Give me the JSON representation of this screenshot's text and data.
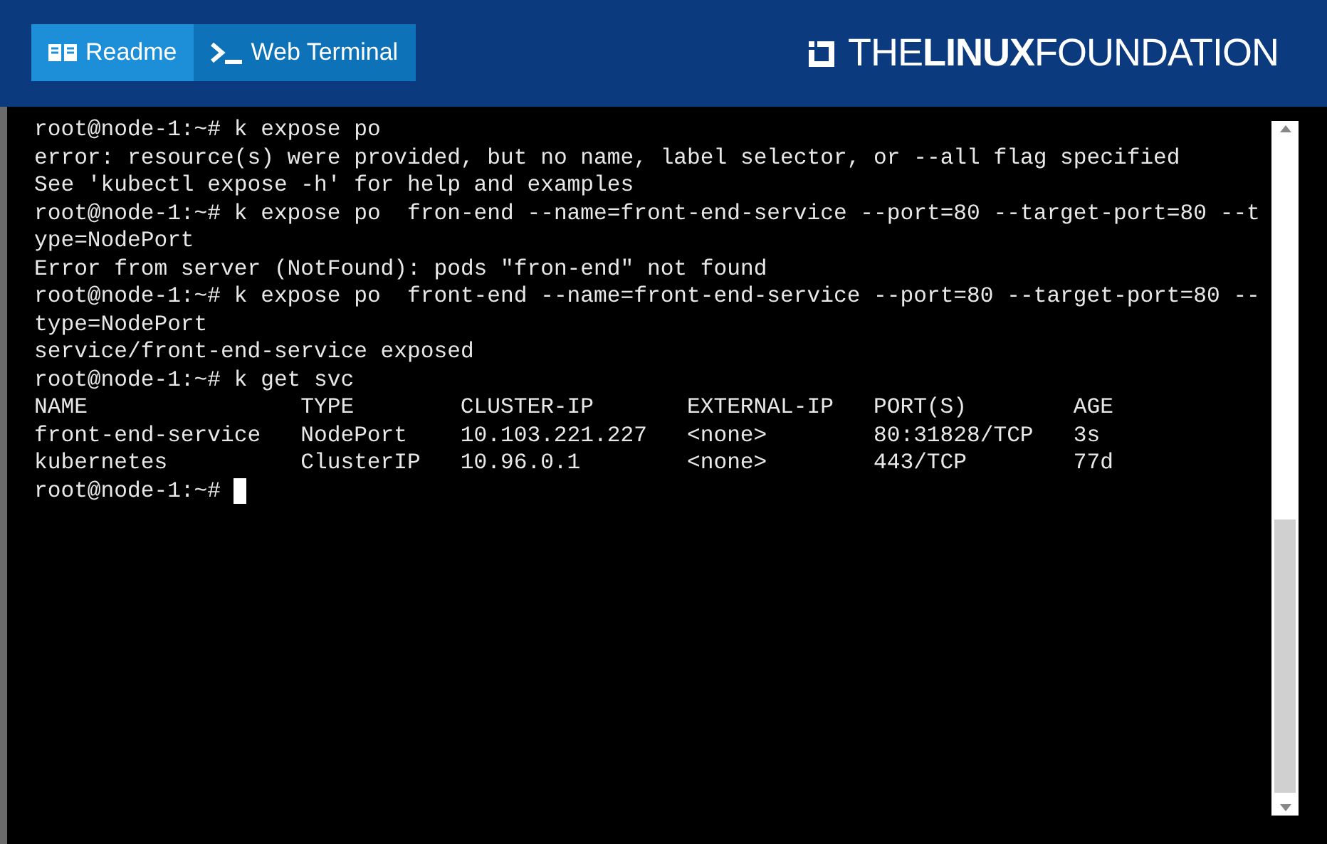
{
  "header": {
    "tabs": [
      {
        "label": "Readme",
        "kind": "book",
        "selected": false
      },
      {
        "label": "Web Terminal",
        "kind": "prompt",
        "selected": true
      }
    ],
    "logo": "THE**LINUX**FOUNDATION"
  },
  "terminal": {
    "lines": [
      "root@node-1:~# k expose po",
      "error: resource(s) were provided, but no name, label selector, or --all flag specified",
      "See 'kubectl expose -h' for help and examples",
      "root@node-1:~# k expose po  fron-end --name=front-end-service --port=80 --target-port=80 --t",
      "ype=NodePort",
      "Error from server (NotFound): pods \"fron-end\" not found",
      "root@node-1:~# k expose po  front-end --name=front-end-service --port=80 --target-port=80 --",
      "type=NodePort",
      "service/front-end-service exposed",
      "root@node-1:~# k get svc"
    ],
    "table": {
      "columns": [
        "NAME",
        "TYPE",
        "CLUSTER-IP",
        "EXTERNAL-IP",
        "PORT(S)",
        "AGE"
      ],
      "rows": [
        [
          "front-end-service",
          "NodePort",
          "10.103.221.227",
          "<none>",
          "80:31828/TCP",
          "3s"
        ],
        [
          "kubernetes",
          "ClusterIP",
          "10.96.0.1",
          "<none>",
          "443/TCP",
          "77d"
        ]
      ]
    },
    "prompt": "root@node-1:~#"
  }
}
